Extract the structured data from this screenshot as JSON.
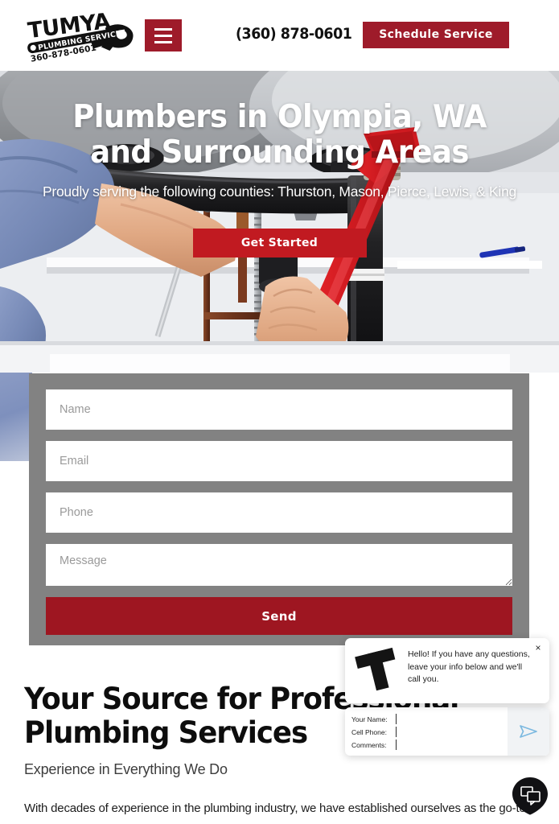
{
  "header": {
    "logo": {
      "name": "TUMYA",
      "tagline": "PLUMBING SERVICES",
      "phone": "360-878-0601",
      "alt": "Tumya Plumbing Services logo"
    },
    "menu_button_label": "Menu",
    "phone": "(360) 878-0601",
    "schedule_label": "Schedule Service"
  },
  "hero": {
    "title": "Plumbers in Olympia, WA and Surrounding Areas",
    "subtitle": "Proudly serving the following counties: Thurston, Mason, Pierce, Lewis, & King",
    "cta_label": "Get Started",
    "image_alt": "Plumber using a red pipe wrench on drain pipes under a stainless steel sink"
  },
  "contact_form": {
    "name_placeholder": "Name",
    "name_value": "",
    "email_placeholder": "Email",
    "email_value": "",
    "phone_placeholder": "Phone",
    "phone_value": "",
    "message_placeholder": "Message",
    "message_value": "",
    "submit_label": "Send"
  },
  "content": {
    "heading": "Your Source for Professional Plumbing Services",
    "subheading": "Experience in Everything We Do",
    "body": "With decades of experience in the plumbing industry, we have established ourselves as the go-to"
  },
  "chat": {
    "greeting": "Hello! If you have any questions, leave your info below and we'll call you.",
    "close_label": "×",
    "avatar_letter": "T",
    "fields": [
      {
        "label": "Your Name:",
        "value": "",
        "name": "your-name"
      },
      {
        "label": "Cell Phone:",
        "value": "",
        "name": "cell-phone"
      },
      {
        "label": "Comments:",
        "value": "",
        "name": "comments"
      }
    ],
    "send_icon": "send-arrow-icon",
    "launcher_icon": "chat-bubbles-icon"
  },
  "colors": {
    "brand_red": "#9e1b2a",
    "cta_red": "#c11a21",
    "send_red": "#9e1621",
    "form_gray": "#828282",
    "text_dark": "#0d0d0d",
    "white": "#ffffff",
    "chat_send_blue": "#7cb9e0"
  }
}
